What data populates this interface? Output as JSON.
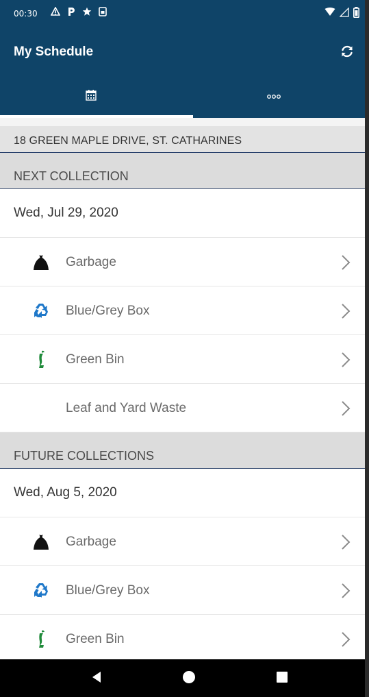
{
  "status_bar": {
    "time": "00:30",
    "left_icons": [
      "warning-icon",
      "parking-icon",
      "star-icon",
      "sim-icon"
    ],
    "right_icons": [
      "wifi-icon",
      "signal-icon",
      "battery-icon"
    ]
  },
  "toolbar": {
    "title": "My Schedule",
    "refresh_icon": "refresh-icon"
  },
  "tabs": [
    {
      "icon": "calendar-icon",
      "selected": true
    },
    {
      "icon": "more-dots-icon",
      "selected": false
    }
  ],
  "address": "18 GREEN MAPLE DRIVE, ST. CATHARINES",
  "sections": {
    "next": {
      "header": "NEXT COLLECTION",
      "date": "Wed, Jul 29, 2020",
      "items": [
        {
          "label": "Garbage",
          "icon": "garbage-bag-icon"
        },
        {
          "label": "Blue/Grey Box",
          "icon": "recycle-icon"
        },
        {
          "label": "Green Bin",
          "icon": "apple-core-icon"
        },
        {
          "label": "Leaf and Yard Waste",
          "icon": ""
        }
      ]
    },
    "future": {
      "header": "FUTURE COLLECTIONS",
      "date": "Wed, Aug 5, 2020",
      "items": [
        {
          "label": "Garbage",
          "icon": "garbage-bag-icon"
        },
        {
          "label": "Blue/Grey Box",
          "icon": "recycle-icon"
        },
        {
          "label": "Green Bin",
          "icon": "apple-core-icon"
        }
      ]
    }
  },
  "colors": {
    "primary": "#0f4468",
    "section_bg": "#dcdcdc",
    "recycle_blue": "#1f78c9",
    "green_bin": "#1f8a3a"
  },
  "nav_bar": [
    "back-icon",
    "home-icon",
    "recents-icon"
  ]
}
